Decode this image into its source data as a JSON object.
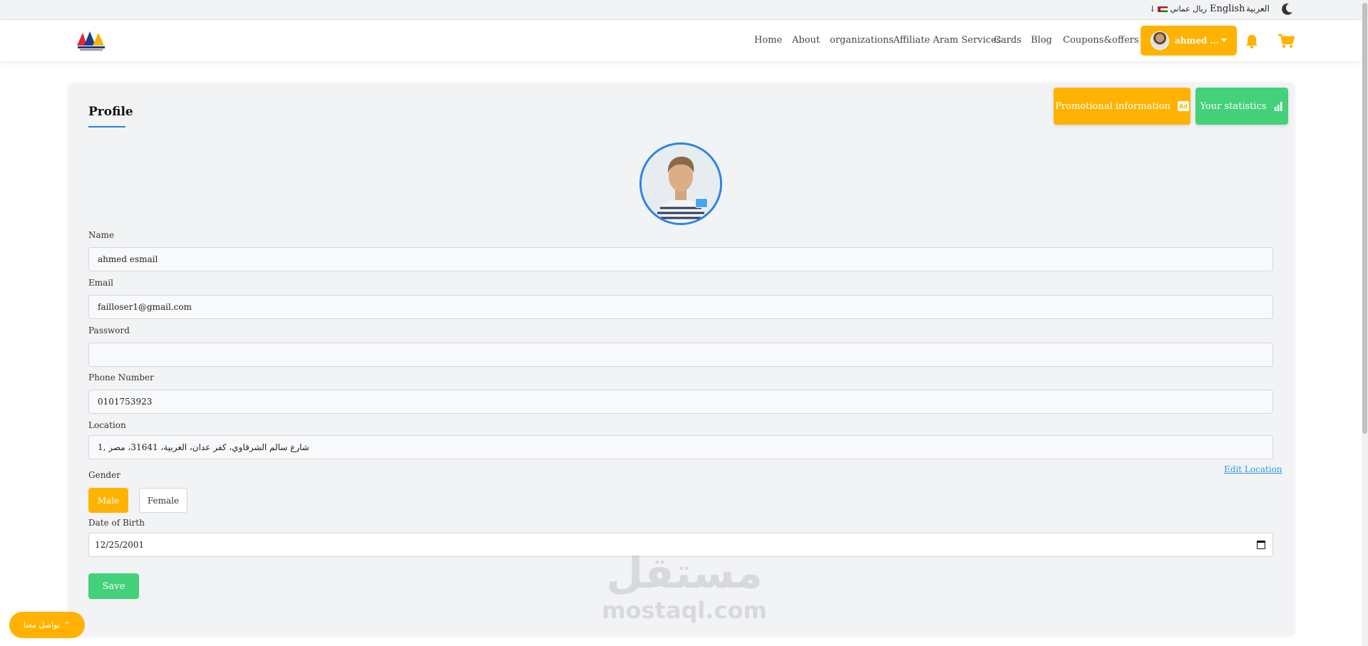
{
  "topbar": {
    "lang_ar": "العربية",
    "lang_en": "English",
    "currency": "ريال عماني",
    "theme_icon": "moon-icon"
  },
  "nav": {
    "items": [
      "Home",
      "About",
      "organizations",
      "Affiliate Aram Services",
      "Cards",
      "Blog",
      "Coupons&offers"
    ],
    "user_name": "ahmed ...",
    "accent": "#ffb300"
  },
  "profile": {
    "title": "Profile",
    "promo_label": "Promotional information",
    "promo_icon_text": "Ad",
    "stats_label": "Your statistics",
    "fields": {
      "name_label": "Name",
      "name_value": "ahmed esmail",
      "email_label": "Email",
      "email_value": "failloser1@gmail.com",
      "password_label": "Password",
      "password_value": "",
      "phone_label": "Phone Number",
      "phone_value": "0101753923",
      "location_label": "Location",
      "location_value": "شارع سالم الشرقاوي، كفر عدان، الغربية، 31641، مصر ,1",
      "edit_location": "Edit Location",
      "gender_label": "Gender",
      "gender_male": "Male",
      "gender_female": "Female",
      "gender_selected": "Male",
      "dob_label": "Date of Birth",
      "dob_value": "12/25/2001"
    },
    "save_label": "Save",
    "colors": {
      "primary": "#ffb300",
      "success": "#43d17a",
      "link": "#2a83e6"
    }
  },
  "watermark": {
    "arabic": "مستقل",
    "latin": "mostaql.com"
  },
  "contact": {
    "label": "تواصل معنا"
  }
}
